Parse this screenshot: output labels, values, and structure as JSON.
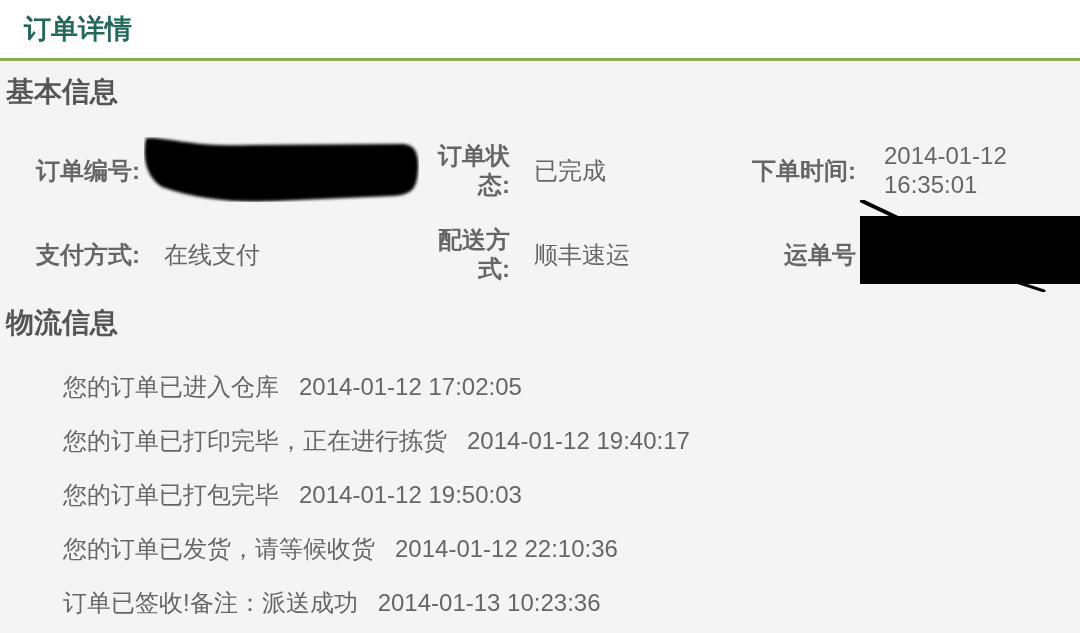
{
  "page": {
    "title": "订单详情"
  },
  "basic_info": {
    "heading": "基本信息",
    "fields": [
      {
        "label": "订单编号:",
        "redacted": true
      },
      {
        "label": "订单状态:",
        "value": "已完成"
      },
      {
        "label": "下单时间:",
        "value": "2014-01-12 16:35:01"
      },
      {
        "label": "支付方式:",
        "value": "在线支付"
      },
      {
        "label": "配送方式:",
        "value": "顺丰速运"
      },
      {
        "label": "运单号",
        "redacted": true
      }
    ]
  },
  "logistics": {
    "heading": "物流信息",
    "events": [
      {
        "message": "您的订单已进入仓库",
        "time": "2014-01-12 17:02:05"
      },
      {
        "message": "您的订单已打印完毕，正在进行拣货",
        "time": "2014-01-12 19:40:17"
      },
      {
        "message": "您的订单已打包完毕",
        "time": "2014-01-12 19:50:03"
      },
      {
        "message": "您的订单已发货，请等候收货",
        "time": "2014-01-12 22:10:36"
      },
      {
        "message": "订单已签收!备注：派送成功",
        "time": "2014-01-13 10:23:36"
      }
    ]
  }
}
